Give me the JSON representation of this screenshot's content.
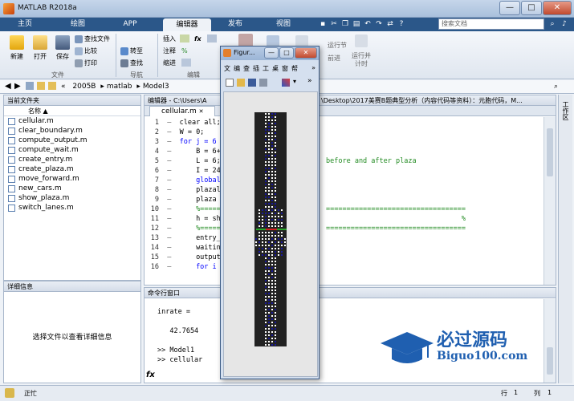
{
  "window": {
    "title": "MATLAB R2018a",
    "min_label": "—",
    "max_label": "□",
    "close_label": "✕"
  },
  "tabs": [
    "主页",
    "绘图",
    "APP",
    "编辑器",
    "发布",
    "视图"
  ],
  "search": {
    "placeholder": "搜索文档"
  },
  "ribbon": {
    "file_group": {
      "new": "新建",
      "open": "打开",
      "save": "保存",
      "find_files": "查找文件",
      "compare": "比较",
      "print": "打印",
      "group_label": "文件"
    },
    "nav_group": {
      "goto": "转至",
      "find": "查找",
      "group_label": "导航"
    },
    "edit_group": {
      "insert": "插入",
      "comment": "注释",
      "indent": "缩进",
      "fx": "fx",
      "pct": "%",
      "group_label": "编辑"
    },
    "run_group": {
      "run_section": "运行节",
      "advance": "前进",
      "run_time": "运行并\n计时"
    }
  },
  "address": {
    "path": [
      "«",
      "2005B",
      "matlab",
      "Model3"
    ]
  },
  "current_folder": {
    "title": "当前文件夹",
    "name_col": "名称",
    "files": [
      "cellular.m",
      "clear_boundary.m",
      "compute_output.m",
      "compute_wait.m",
      "create_entry.m",
      "create_plaza.m",
      "move_forward.m",
      "new_cars.m",
      "show_plaza.m",
      "switch_lanes.m"
    ]
  },
  "details": {
    "title": "详细信息",
    "message": "选择文件以查看详细信息"
  },
  "editor": {
    "title": "编辑器 - C:\\Users\\A",
    "title_tail": "\\Desktop\\2017美赛B题典型分析（内容代码等资料）：元胞代码，M...",
    "tab": "cellular.m",
    "lines": [
      {
        "n": "1",
        "code": "clear all;",
        "hidden": ""
      },
      {
        "n": "2",
        "code": "W = 0;",
        "hidden": ""
      },
      {
        "n": "3",
        "code": "for j = 6",
        "hidden": ""
      },
      {
        "n": "4",
        "code": "    B = 6+",
        "hidden": ""
      },
      {
        "n": "5",
        "code": "    L = 6;",
        "hidden": "before and after plaza"
      },
      {
        "n": "6",
        "code": "    I = 24",
        "hidden": ""
      },
      {
        "n": "7",
        "code": "    global",
        "hidden": ""
      },
      {
        "n": "8",
        "code": "    plazal",
        "hidden": ""
      },
      {
        "n": "9",
        "code": "    plaza ",
        "hidden": ""
      },
      {
        "n": "10",
        "code": "    %=====",
        "hidden": "=================================="
      },
      {
        "n": "11",
        "code": "    h = sho",
        "hidden": "                                 %"
      },
      {
        "n": "12",
        "code": "    %=====",
        "hidden": "=================================="
      },
      {
        "n": "13",
        "code": "    entry_",
        "hidden": ""
      },
      {
        "n": "14",
        "code": "    waitin",
        "hidden": ""
      },
      {
        "n": "15",
        "code": "    output",
        "hidden": ""
      },
      {
        "n": "16",
        "code": "    for i =",
        "hidden": ""
      }
    ]
  },
  "command_window": {
    "title": "命令行窗口",
    "lines": [
      "inrate =",
      "",
      "   42.7654",
      "",
      ">> Model1",
      ">> cellular"
    ],
    "fx": "fx"
  },
  "right_strip": {
    "label": "工作区"
  },
  "status": {
    "state": "正忙",
    "row_label": "行",
    "row": "1",
    "col_label": "列",
    "col": "1"
  },
  "figure": {
    "title": "Figur...",
    "menu": [
      "文",
      "编",
      "查",
      "插",
      "工",
      "桌",
      "窗",
      "帮"
    ],
    "more": "»"
  },
  "watermark": {
    "cn": "必过源码",
    "en": "Biguo100.com"
  },
  "colors": {
    "ribbon_tab_bg": "#2b5789",
    "cell_car": "#1a1a9c",
    "cell_empty": "#ffffff",
    "boundary": "#222222",
    "accent_green": "#2aa52a",
    "accent_red": "#d42020"
  }
}
